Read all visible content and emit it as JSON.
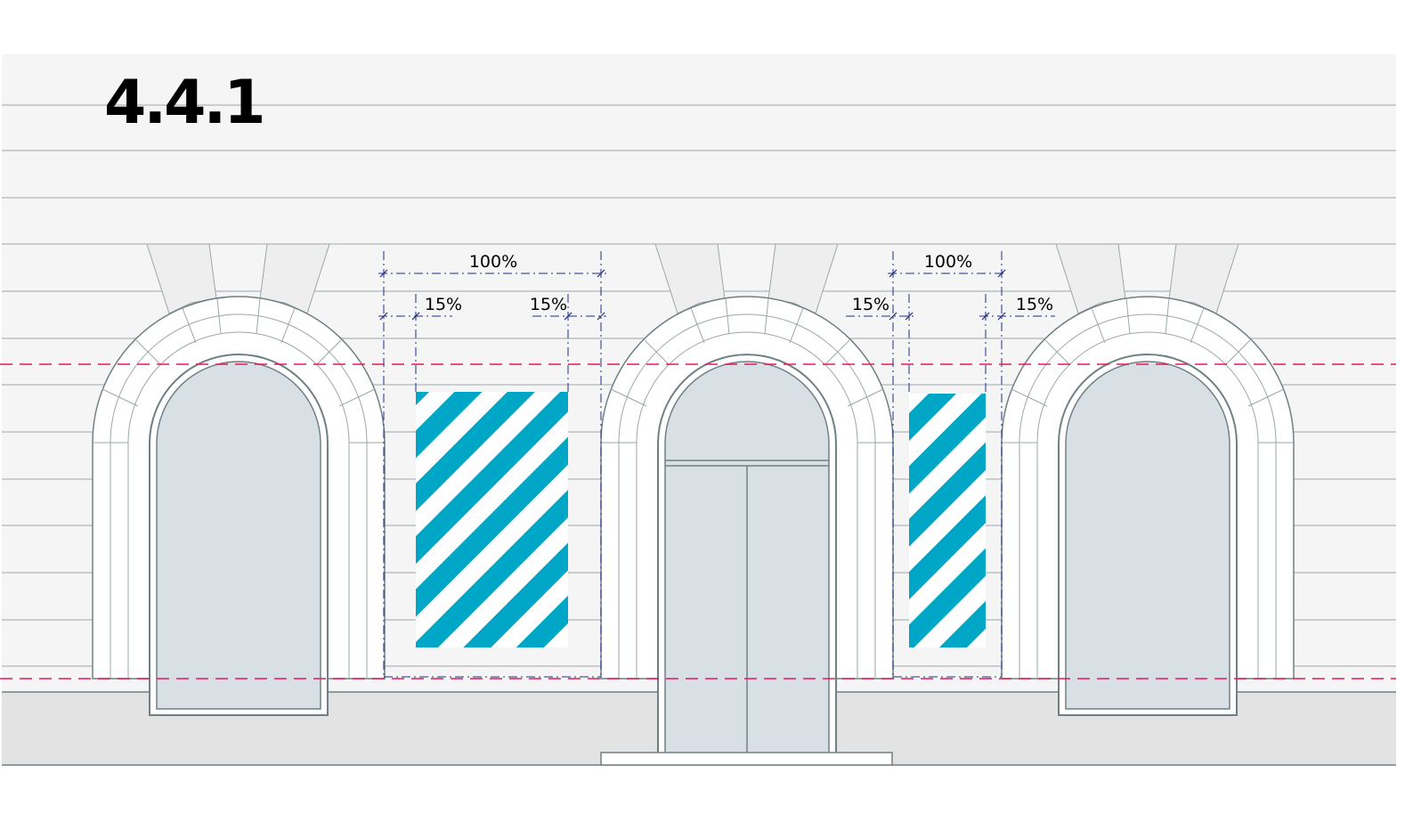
{
  "section_number": "4.4.1",
  "dimension_labels": {
    "left_total": "100%",
    "left_margin_left": "15%",
    "left_margin_right": "15%",
    "right_total": "100%",
    "right_margin_left": "15%",
    "right_margin_right": "15%"
  },
  "colors": {
    "stripe": "#00a6c6",
    "guide_line": "#e5195a",
    "dimension_line": "#1a2d8c",
    "glass": "#d8e0e6",
    "wall": "#f5f5f5",
    "plinth": "#e3e3e3",
    "outline": "#6f8084"
  }
}
